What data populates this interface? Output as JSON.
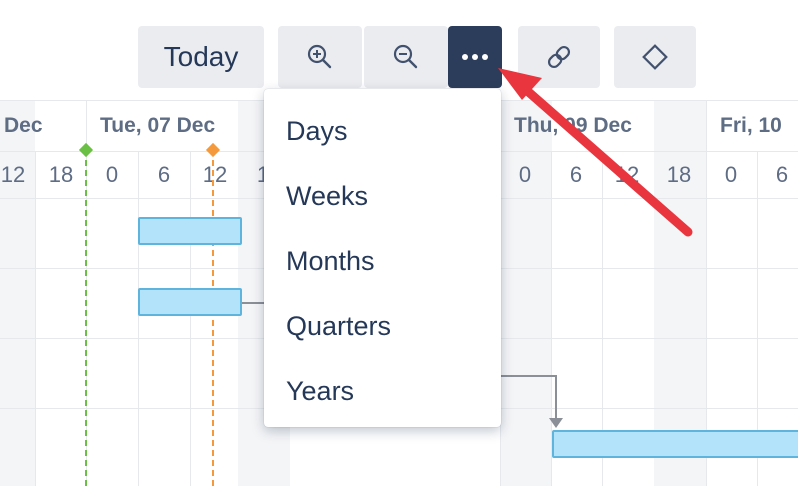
{
  "toolbar": {
    "today_label": "Today",
    "zoom_in_icon": "zoom-in-icon",
    "zoom_out_icon": "zoom-out-icon",
    "more_icon": "ellipsis-icon",
    "link_icon": "link-icon",
    "milestone_icon": "diamond-icon"
  },
  "timeline": {
    "days": [
      {
        "label": "Dec"
      },
      {
        "label": "Tue, 07 Dec"
      },
      {
        "label": "Thu, 09 Dec"
      },
      {
        "label": "Fri, 10"
      }
    ],
    "hours_left": [
      "12",
      "18",
      "0",
      "6",
      "12",
      "1"
    ],
    "hours_right": [
      "0",
      "6",
      "12",
      "18",
      "0",
      "6"
    ]
  },
  "menu": {
    "items": [
      {
        "label": "Days"
      },
      {
        "label": "Weeks"
      },
      {
        "label": "Months"
      },
      {
        "label": "Quarters"
      },
      {
        "label": "Years"
      }
    ]
  },
  "colors": {
    "today_marker": "#6abf45",
    "current_marker": "#f59a3c",
    "bar_fill": "#b3e2fb",
    "bar_border": "#5fb4de",
    "more_button": "#2c3d5b",
    "annotation_arrow": "#e8353e"
  }
}
